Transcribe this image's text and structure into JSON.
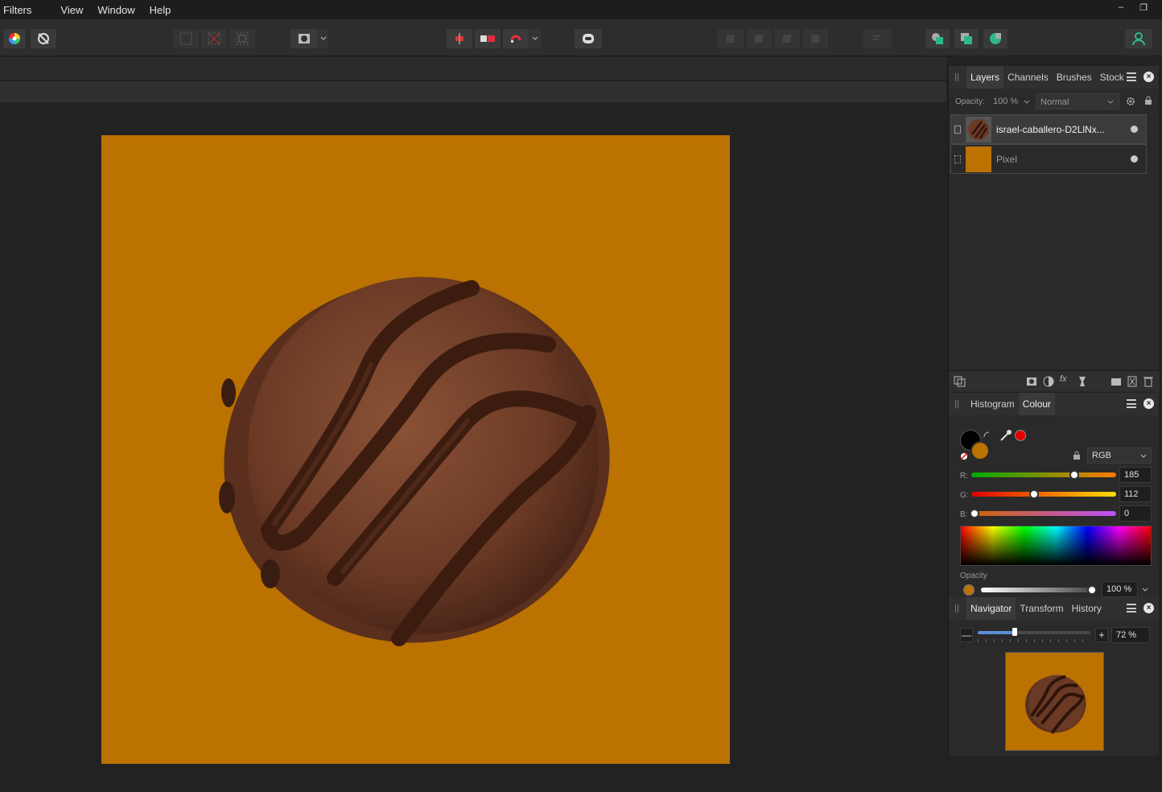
{
  "menu": [
    "Filters",
    "View",
    "Window",
    "Help"
  ],
  "window_controls": {
    "minimize": "–",
    "restore": "❐"
  },
  "layers_panel": {
    "tabs": [
      "Layers",
      "Channels",
      "Brushes",
      "Stock"
    ],
    "active_tab": "Layers",
    "opacity_label": "Opacity:",
    "opacity_value": "100 %",
    "blend_mode": "Normal",
    "layers": [
      {
        "name": "israel-caballero-D2LlNx...",
        "selected": true
      },
      {
        "name": "Pixel",
        "selected": false
      }
    ]
  },
  "colour_panel": {
    "tabs": [
      "Histogram",
      "Colour"
    ],
    "active_tab": "Colour",
    "model": "RGB",
    "r_label": "R:",
    "r_value": "185",
    "g_label": "G:",
    "g_value": "112",
    "b_label": "B:",
    "b_value": "0",
    "opacity_label": "Opacity",
    "opacity_value": "100 %"
  },
  "navigator_panel": {
    "tabs": [
      "Navigator",
      "Transform",
      "History"
    ],
    "active_tab": "Navigator",
    "zoom_value": "72 %",
    "zoom_out": "—",
    "zoom_in": "+"
  },
  "colors": {
    "canvas_bg": "#bb7200",
    "swatch_primary": "#000000",
    "swatch_secondary": "#bb7200",
    "accent_red": "#e00000"
  }
}
